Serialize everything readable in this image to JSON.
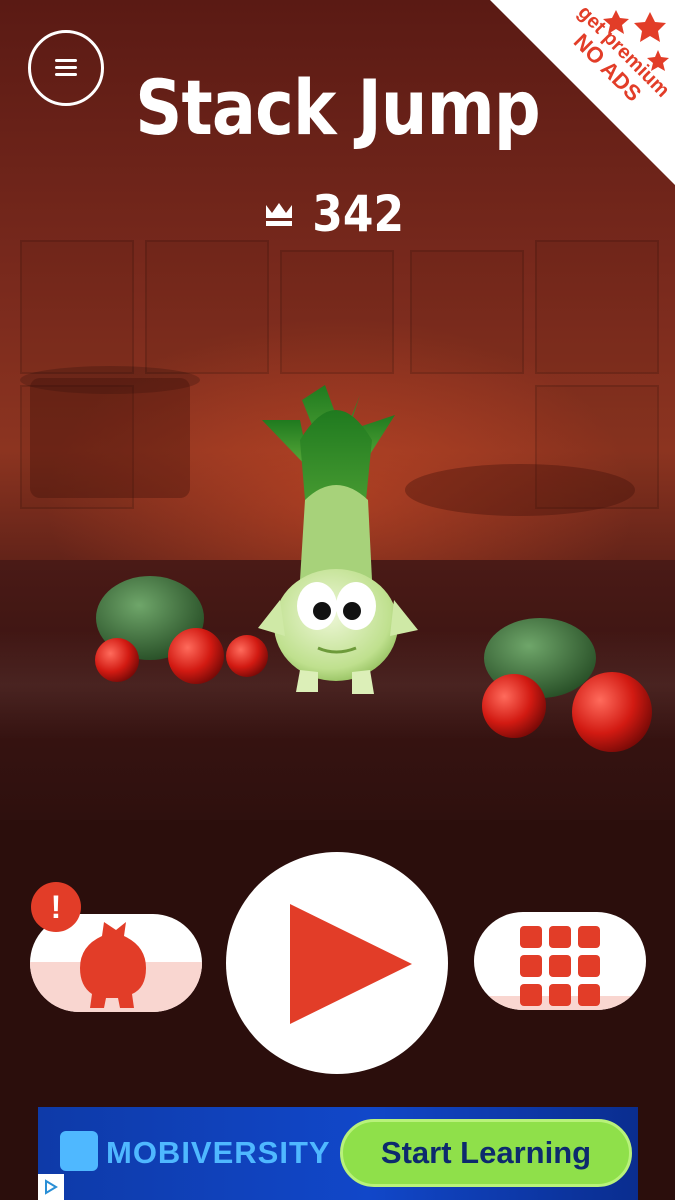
{
  "title": "Stack Jump",
  "best_score": "342",
  "premium": {
    "line1": "get premium",
    "line2": "NO ADS"
  },
  "alert_badge": "!",
  "ad": {
    "brand": "MOBIVERSITY",
    "cta": "Start Learning"
  },
  "icons": {
    "menu": "hamburger-menu-icon",
    "crown": "crown-icon",
    "play": "play-triangle-icon",
    "piggy": "piggy-bank-icon",
    "grid": "grid-icon",
    "star": "star-icon",
    "ad_choices": "ad-choices-icon"
  },
  "colors": {
    "accent": "#e23d28",
    "white": "#ffffff",
    "ad_cta": "#8fe04a"
  }
}
